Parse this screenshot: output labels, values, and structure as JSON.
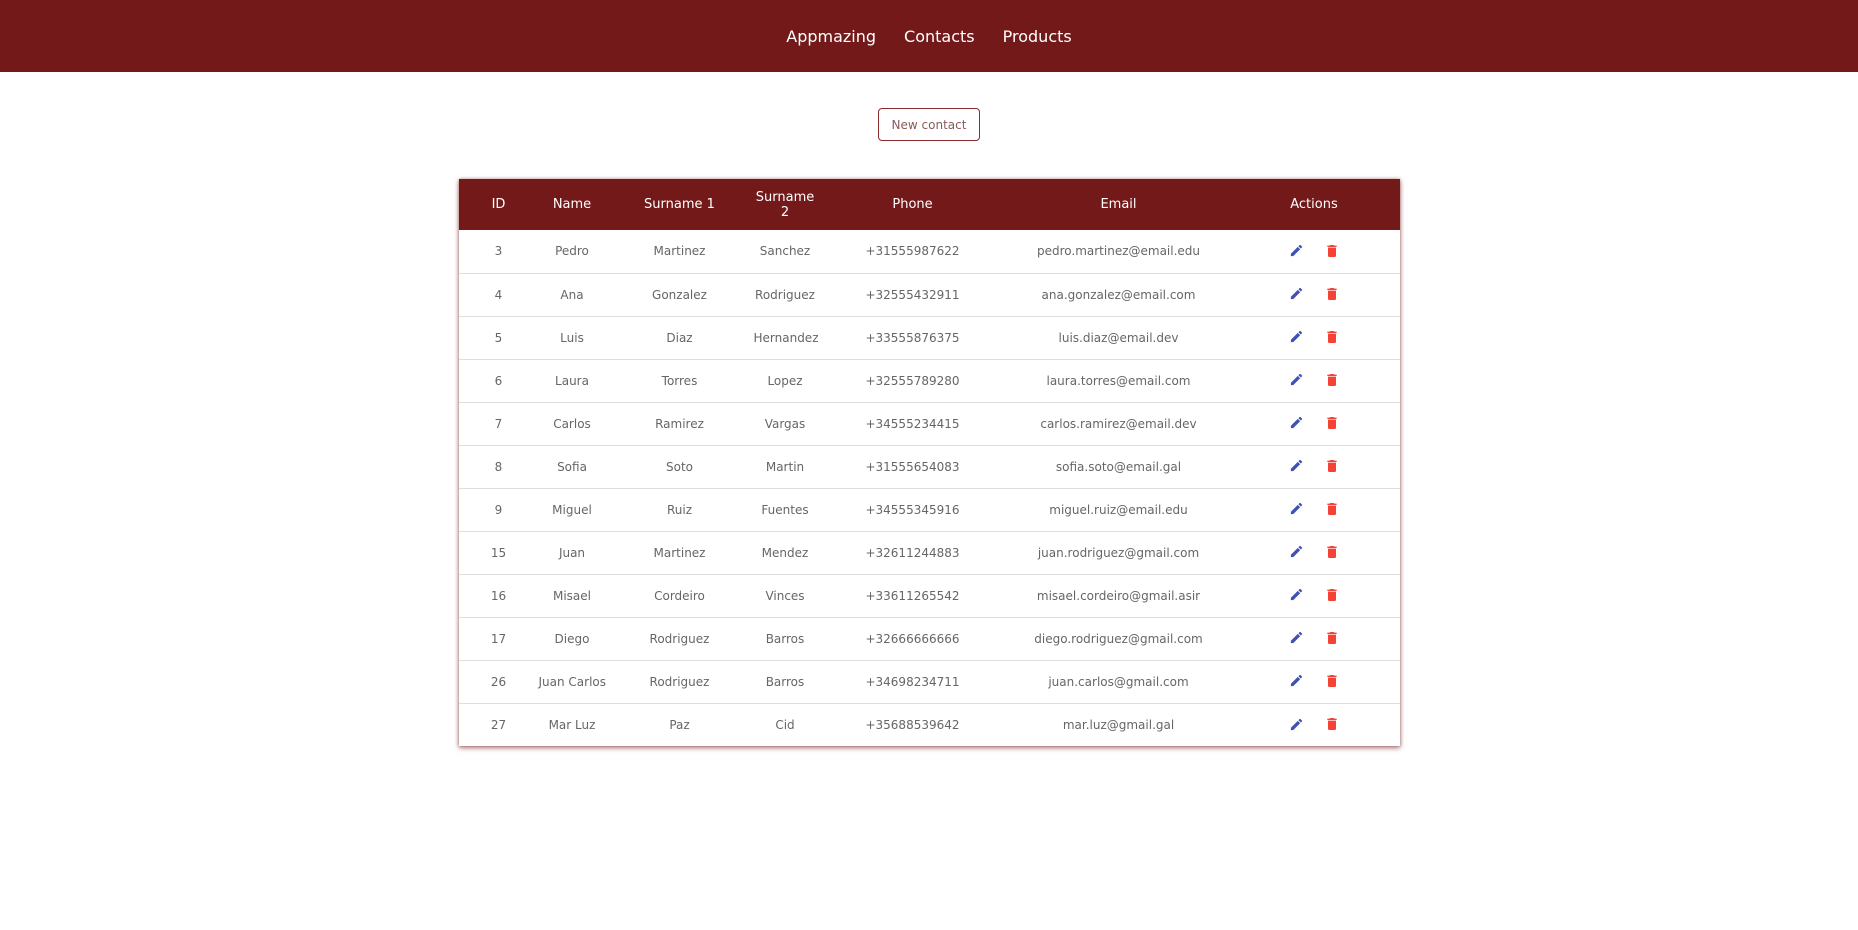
{
  "nav": {
    "links": [
      "Appmazing",
      "Contacts",
      "Products"
    ]
  },
  "toolbar": {
    "new_contact_label": "New contact"
  },
  "table": {
    "headers": [
      "ID",
      "Name",
      "Surname 1",
      "Surname 2",
      "Phone",
      "Email",
      "Actions"
    ],
    "rows": [
      [
        "3",
        "Pedro",
        "Martinez",
        "Sanchez",
        "+31555987622",
        "pedro.martinez@email.edu"
      ],
      [
        "4",
        "Ana",
        "Gonzalez",
        "Rodriguez",
        "+32555432911",
        "ana.gonzalez@email.com"
      ],
      [
        "5",
        "Luis",
        "Diaz",
        "Hernandez",
        "+33555876375",
        "luis.diaz@email.dev"
      ],
      [
        "6",
        "Laura",
        "Torres",
        "Lopez",
        "+32555789280",
        "laura.torres@email.com"
      ],
      [
        "7",
        "Carlos",
        "Ramirez",
        "Vargas",
        "+34555234415",
        "carlos.ramirez@email.dev"
      ],
      [
        "8",
        "Sofia",
        "Soto",
        "Martin",
        "+31555654083",
        "sofia.soto@email.gal"
      ],
      [
        "9",
        "Miguel",
        "Ruiz",
        "Fuentes",
        "+34555345916",
        "miguel.ruiz@email.edu"
      ],
      [
        "15",
        "Juan",
        "Martinez",
        "Mendez",
        "+32611244883",
        "juan.rodriguez@gmail.com"
      ],
      [
        "16",
        "Misael",
        "Cordeiro",
        "Vinces",
        "+33611265542",
        "misael.cordeiro@gmail.asir"
      ],
      [
        "17",
        "Diego",
        "Rodriguez",
        "Barros",
        "+32666666666",
        "diego.rodriguez@gmail.com"
      ],
      [
        "26",
        "Juan Carlos",
        "Rodriguez",
        "Barros",
        "+34698234711",
        "juan.carlos@gmail.com"
      ],
      [
        "27",
        "Mar Luz",
        "Paz",
        "Cid",
        "+35688539642",
        "mar.luz@gmail.gal"
      ]
    ]
  },
  "icons": {
    "edit": "pencil-icon",
    "delete": "trash-icon"
  },
  "colors": {
    "brand": "#731919",
    "edit_icon": "#3f51b5",
    "delete_icon": "#f44336"
  }
}
